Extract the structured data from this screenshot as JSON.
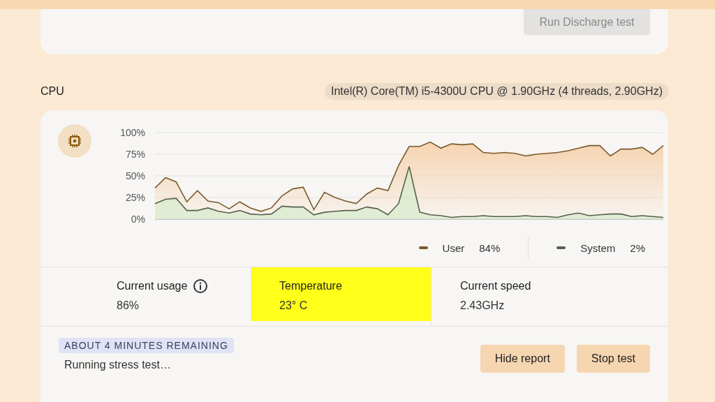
{
  "battery_card": {
    "button": {
      "label": "Run Discharge test",
      "disabled": true
    }
  },
  "cpu": {
    "title": "CPU",
    "model": "Intel(R) Core(TM) i5-4300U CPU @ 1.90GHz (4 threads, 2.90GHz)",
    "chart_data": {
      "type": "area",
      "grid": true,
      "ylim": [
        0,
        100
      ],
      "yticks": [
        {
          "value": 0,
          "label": "0%"
        },
        {
          "value": 25,
          "label": "25%"
        },
        {
          "value": 50,
          "label": "50%"
        },
        {
          "value": 75,
          "label": "75%"
        },
        {
          "value": 100,
          "label": "100%"
        }
      ],
      "series": [
        {
          "name": "User",
          "color": "#7a5a2a",
          "values": [
            36,
            48,
            43,
            20,
            33,
            21,
            19,
            12,
            20,
            13,
            9,
            13,
            27,
            35,
            37,
            11,
            31,
            25,
            21,
            18,
            29,
            36,
            33,
            62,
            84,
            84,
            89,
            82,
            87,
            86,
            87,
            77,
            76,
            77,
            76,
            73,
            75,
            76,
            77,
            79,
            82,
            85,
            85,
            73,
            81,
            81,
            83,
            75,
            85
          ]
        },
        {
          "name": "System",
          "color": "#55604a",
          "values": [
            18,
            23,
            24,
            10,
            10,
            13,
            9,
            7,
            10,
            6,
            5,
            6,
            15,
            14,
            14,
            5,
            8,
            9,
            10,
            10,
            14,
            12,
            5,
            18,
            61,
            8,
            5,
            4,
            2,
            3,
            3,
            4,
            3,
            3,
            3,
            4,
            3,
            3,
            2,
            5,
            7,
            4,
            5,
            6,
            6,
            3,
            4,
            3,
            2
          ]
        }
      ]
    },
    "legend": [
      {
        "value": "84%"
      },
      {
        "value": "2%"
      }
    ],
    "stats": [
      {
        "label": "Current usage",
        "value": "86%",
        "info": true,
        "highlighted": false
      },
      {
        "label": "Temperature",
        "value": "23° C",
        "info": false,
        "highlighted": true
      },
      {
        "label": "Current speed",
        "value": "2.43GHz",
        "info": false,
        "highlighted": false
      }
    ],
    "remaining": "ABOUT 4 MINUTES REMAINING",
    "status": "Running stress test…",
    "buttons": [
      {
        "label": "Hide report"
      },
      {
        "label": "Stop test"
      }
    ]
  }
}
